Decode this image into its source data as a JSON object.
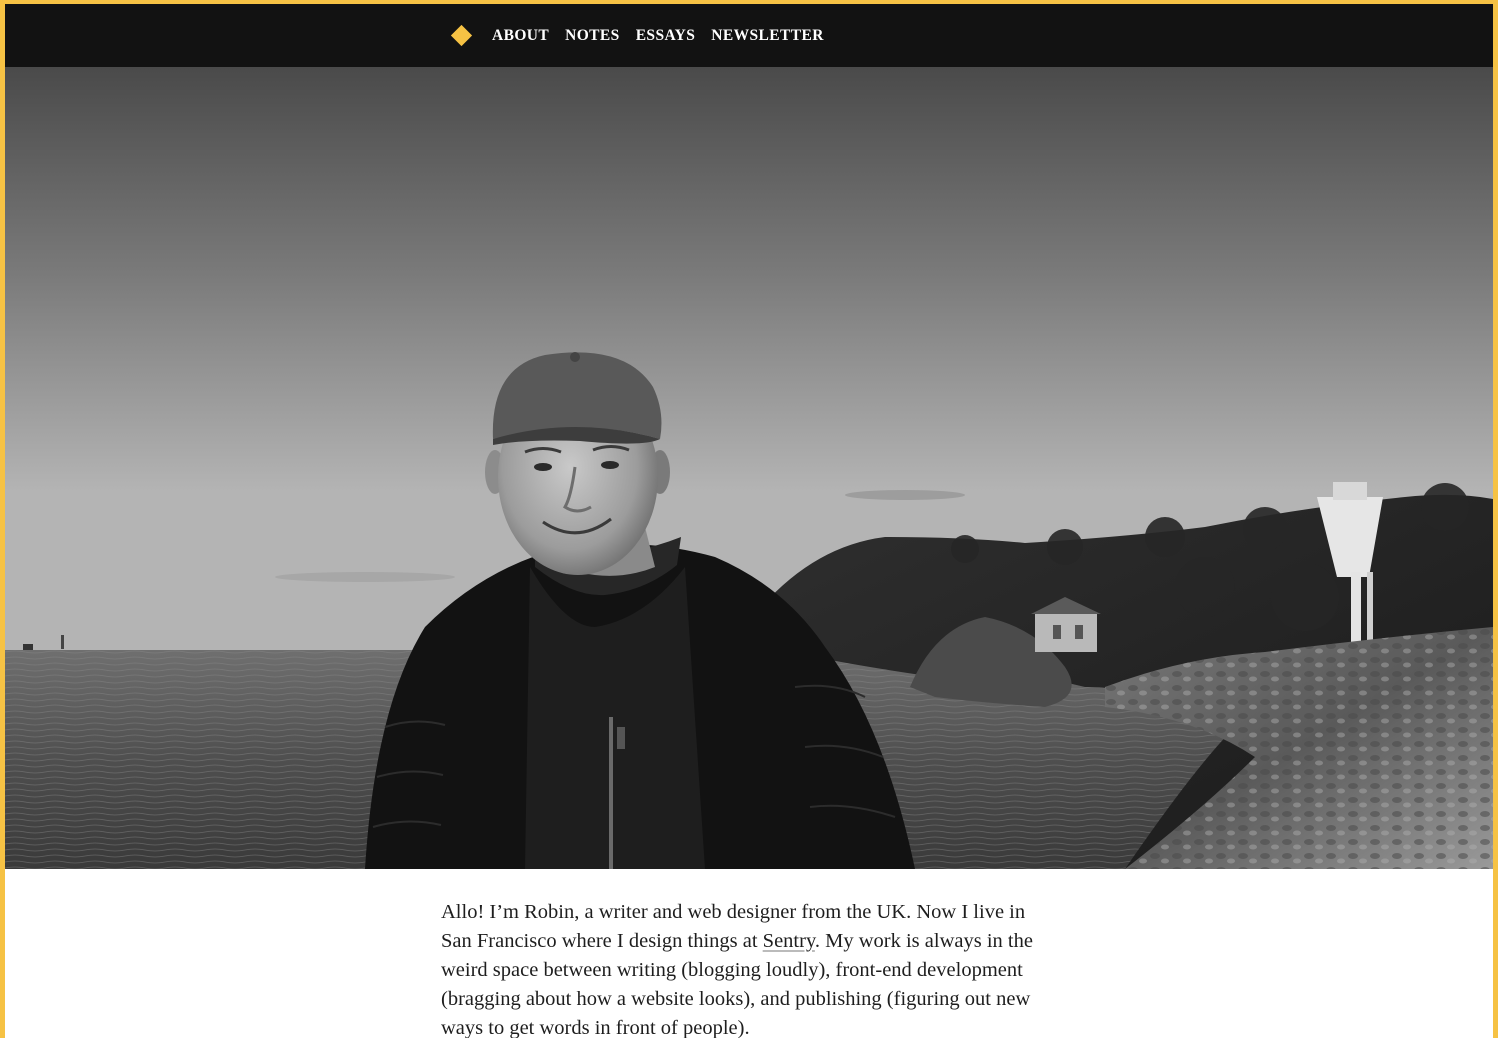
{
  "nav": {
    "logo_icon": "diamond-logo-icon",
    "accent_color": "#f6c244",
    "items": [
      {
        "label": "ABOUT"
      },
      {
        "label": "NOTES"
      },
      {
        "label": "ESSAYS"
      },
      {
        "label": "NEWSLETTER"
      }
    ]
  },
  "hero": {
    "style": "black-and-white photo of a smiling man in a cap and puffer jacket by the sea"
  },
  "intro": {
    "text_before_link": "Allo! I’m Robin, a writer and web designer from the UK. Now I live in San Francisco where I design things at ",
    "link_label": "Sentry",
    "text_after_link": ". My work is always in the weird space between writing (blogging loudly), front-end development (bragging about how a website looks), and publishing (figuring out new ways to get words in front of people)."
  }
}
